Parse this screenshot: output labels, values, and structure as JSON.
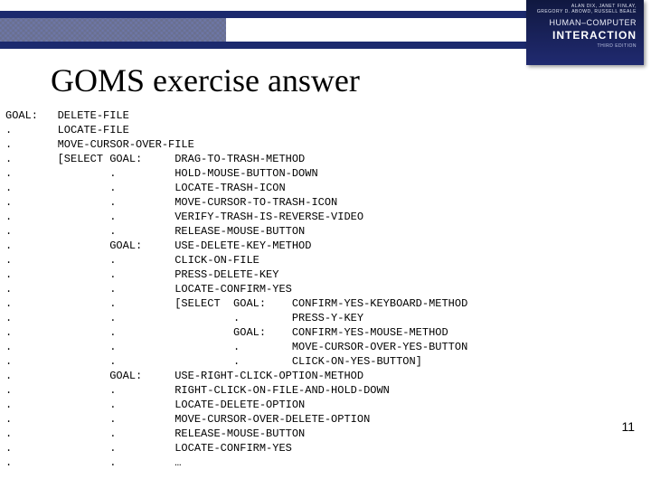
{
  "book": {
    "authors": "ALAN DIX, JANET FINLAY,\nGREGORY D. ABOWD, RUSSELL BEALE",
    "title_top": "HUMAN–COMPUTER",
    "title_bottom": "INTERACTION",
    "edition": "THIRD EDITION"
  },
  "slide": {
    "title": "GOMS exercise answer",
    "page_number": "11",
    "goms": "GOAL:   DELETE-FILE\n.       LOCATE-FILE\n.       MOVE-CURSOR-OVER-FILE\n.       [SELECT GOAL:     DRAG-TO-TRASH-METHOD\n.               .         HOLD-MOUSE-BUTTON-DOWN\n.               .         LOCATE-TRASH-ICON\n.               .         MOVE-CURSOR-TO-TRASH-ICON\n.               .         VERIFY-TRASH-IS-REVERSE-VIDEO\n.               .         RELEASE-MOUSE-BUTTON\n.               GOAL:     USE-DELETE-KEY-METHOD\n.               .         CLICK-ON-FILE\n.               .         PRESS-DELETE-KEY\n.               .         LOCATE-CONFIRM-YES\n.               .         [SELECT  GOAL:    CONFIRM-YES-KEYBOARD-METHOD\n.               .                  .        PRESS-Y-KEY\n.               .                  GOAL:    CONFIRM-YES-MOUSE-METHOD\n.               .                  .        MOVE-CURSOR-OVER-YES-BUTTON\n.               .                  .        CLICK-ON-YES-BUTTON]\n.               GOAL:     USE-RIGHT-CLICK-OPTION-METHOD\n.               .         RIGHT-CLICK-ON-FILE-AND-HOLD-DOWN\n.               .         LOCATE-DELETE-OPTION\n.               .         MOVE-CURSOR-OVER-DELETE-OPTION\n.               .         RELEASE-MOUSE-BUTTON\n.               .         LOCATE-CONFIRM-YES\n.               .         …"
  }
}
